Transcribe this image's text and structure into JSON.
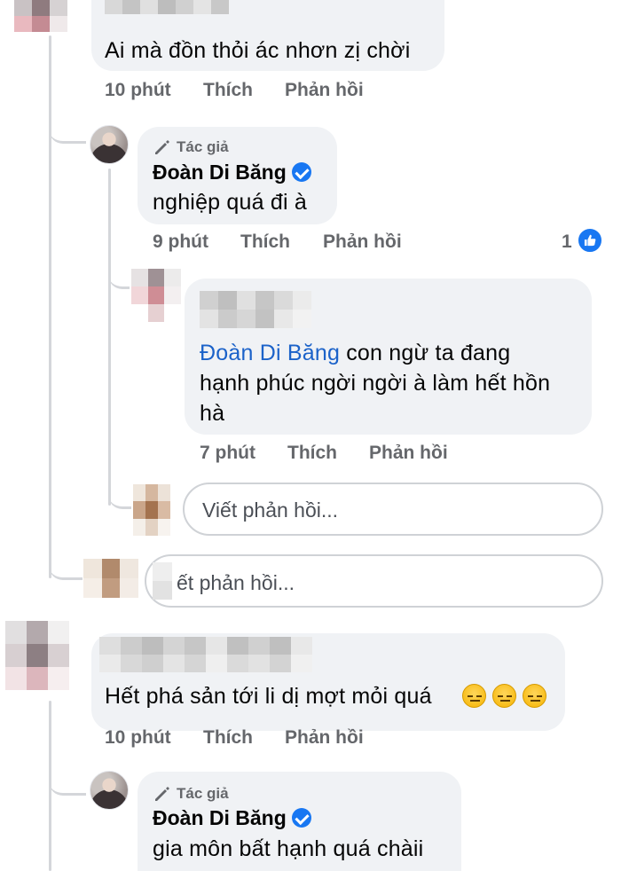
{
  "thread": {
    "comment1": {
      "text": "Ai mà đồn thỏi ác nhơn zị chời",
      "time": "10 phút",
      "like": "Thích",
      "reply": "Phản hồi"
    },
    "reply1": {
      "badge": "Tác giả",
      "author": "Đoàn Di Băng",
      "text": "nghiệp quá đi à",
      "time": "9 phút",
      "like": "Thích",
      "reply": "Phản hồi",
      "reaction_count": "1",
      "reaction_icon": "like-icon"
    },
    "reply2": {
      "mention": "Đoàn Di Băng",
      "text_line1": " con ngừ ta đang",
      "text_line2": "hạnh phúc ngời ngời à làm hết hồn",
      "text_line3": "hà",
      "time": "7 phút",
      "like": "Thích",
      "reply": "Phản hồi"
    },
    "reply_box_inner": {
      "placeholder": "Viết phản hồi..."
    },
    "reply_box_outer": {
      "placeholder": "ết phản hồi..."
    },
    "comment2": {
      "text": "Hết phá sản tới li dị mợt mỏi quá",
      "emojis": [
        "expressionless-face",
        "expressionless-face",
        "expressionless-face"
      ],
      "time": "10 phút",
      "like": "Thích",
      "reply": "Phản hồi"
    },
    "reply3": {
      "badge": "Tác giả",
      "author": "Đoàn Di Băng",
      "text": "gia môn bất hạnh quá chàii"
    }
  },
  "colors": {
    "bubble": "#f0f2f5",
    "meta": "#65676b",
    "mention": "#1b62c9",
    "verified": "#1877f2",
    "thread_line": "#d4d6da"
  }
}
